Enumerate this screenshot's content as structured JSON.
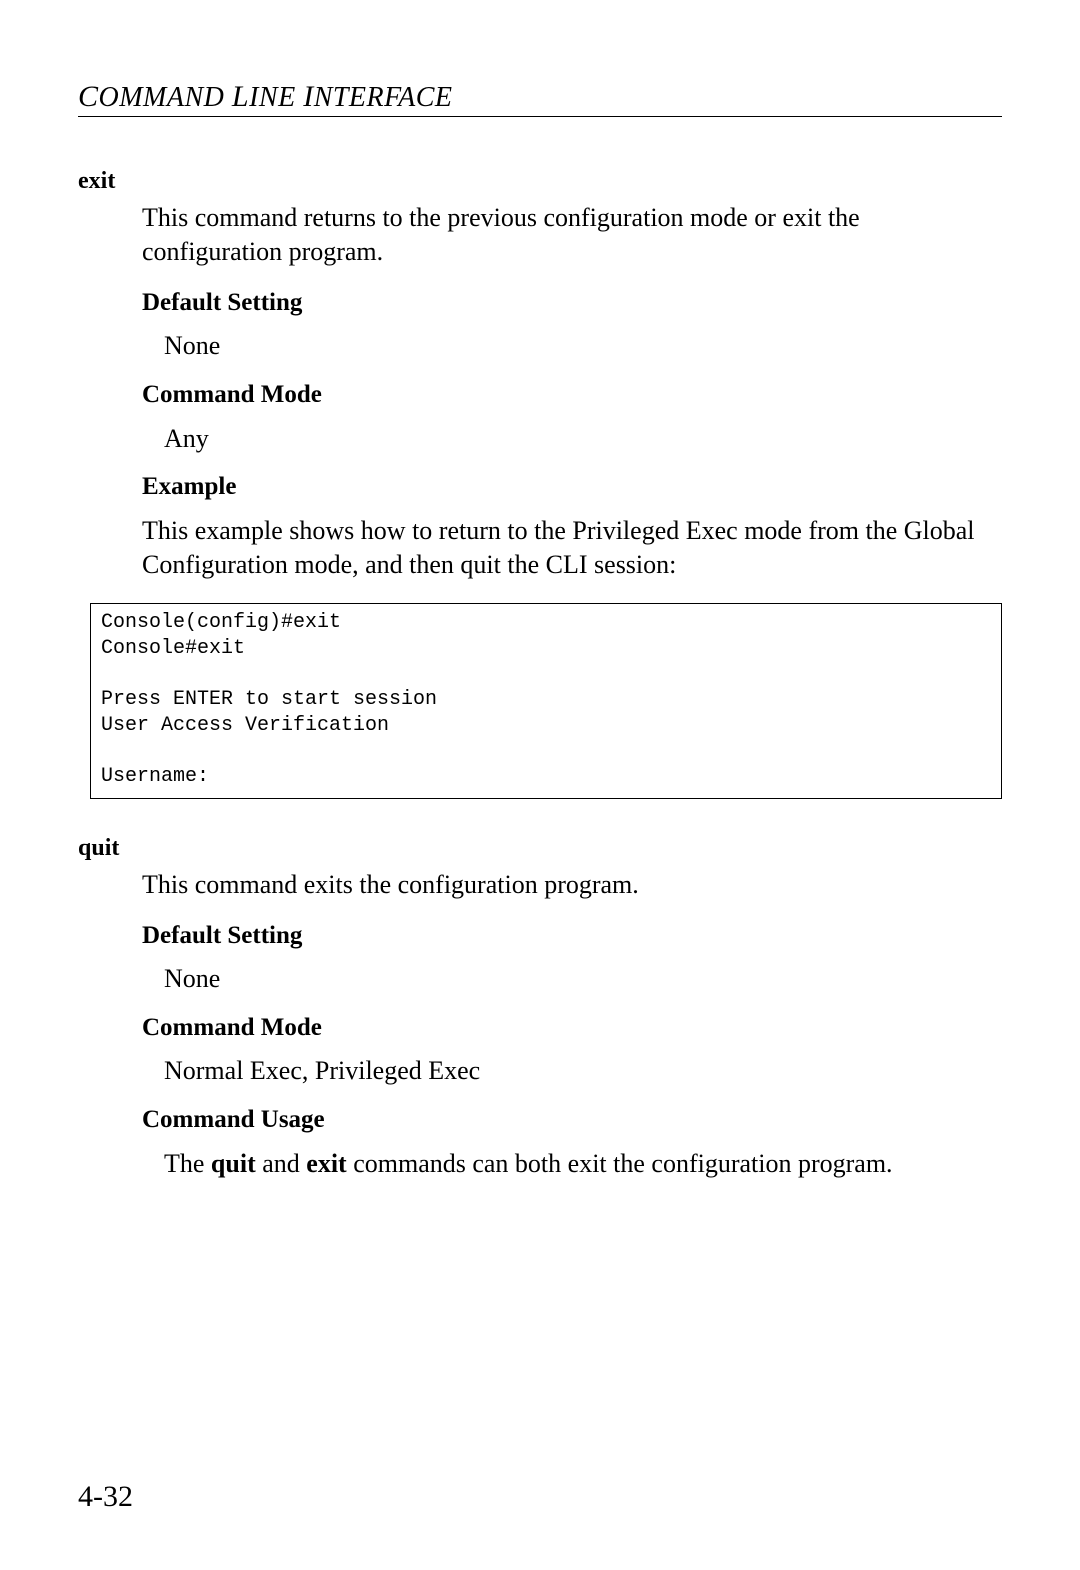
{
  "header": {
    "running_title": "Command Line Interface"
  },
  "sections": {
    "exit": {
      "name": "exit",
      "description": "This command returns to the previous configuration mode or exit the configuration program.",
      "default_setting": {
        "heading": "Default Setting",
        "value": "None"
      },
      "command_mode": {
        "heading": "Command Mode",
        "value": "Any"
      },
      "example": {
        "heading": "Example",
        "intro": "This example shows how to return to the Privileged Exec mode from the Global Configuration mode, and then quit the CLI session:",
        "code": "Console(config)#exit\nConsole#exit\n\nPress ENTER to start session\nUser Access Verification\n\nUsername:"
      }
    },
    "quit": {
      "name": "quit",
      "description": "This command exits the configuration program.",
      "default_setting": {
        "heading": "Default Setting",
        "value": "None"
      },
      "command_mode": {
        "heading": "Command Mode",
        "value": "Normal Exec, Privileged Exec"
      },
      "command_usage": {
        "heading": "Command Usage",
        "prefix": "The ",
        "bold1": "quit",
        "mid": " and ",
        "bold2": "exit",
        "suffix": " commands can both exit the configuration program."
      }
    }
  },
  "page_number": "4-32"
}
